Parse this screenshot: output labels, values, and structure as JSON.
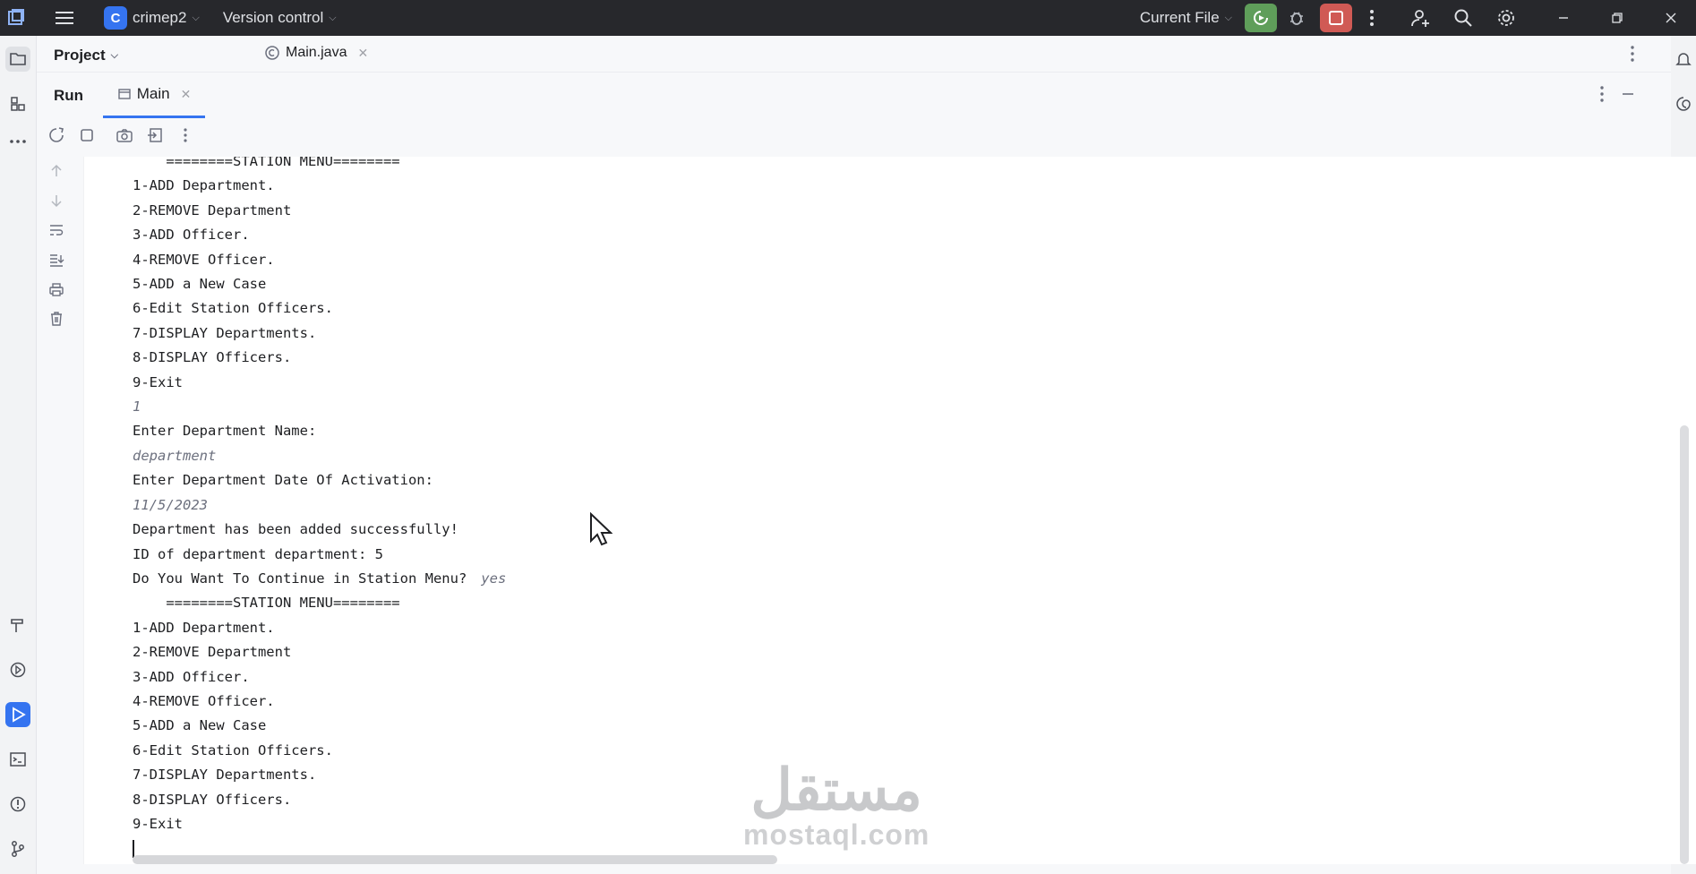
{
  "titlebar": {
    "project_initial": "C",
    "project_name": "crimep2",
    "vcs_label": "Version control",
    "run_config": "Current File"
  },
  "header": {
    "project_label": "Project",
    "file_tab": "Main.java"
  },
  "run_panel": {
    "tool_label": "Run",
    "tab_label": "Main"
  },
  "console": {
    "lines": [
      {
        "text": "    ========STATION MENU========",
        "type": "out"
      },
      {
        "text": "1-ADD Department.",
        "type": "out"
      },
      {
        "text": "2-REMOVE Department",
        "type": "out"
      },
      {
        "text": "3-ADD Officer.",
        "type": "out"
      },
      {
        "text": "4-REMOVE Officer.",
        "type": "out"
      },
      {
        "text": "5-ADD a New Case",
        "type": "out"
      },
      {
        "text": "6-Edit Station Officers.",
        "type": "out"
      },
      {
        "text": "7-DISPLAY Departments.",
        "type": "out"
      },
      {
        "text": "8-DISPLAY Officers.",
        "type": "out"
      },
      {
        "text": "9-Exit",
        "type": "out"
      },
      {
        "text": "1",
        "type": "input"
      },
      {
        "text": "Enter Department Name:",
        "type": "out"
      },
      {
        "text": "department",
        "type": "input"
      },
      {
        "text": "Enter Department Date Of Activation:",
        "type": "out"
      },
      {
        "text": "11/5/2023",
        "type": "input"
      },
      {
        "text": "Department has been added successfully!",
        "type": "out"
      },
      {
        "text": "ID of department department: 5",
        "type": "out"
      },
      {
        "text": "Do You Want To Continue in Station Menu?",
        "type": "out",
        "input": "yes"
      },
      {
        "text": "    ========STATION MENU========",
        "type": "out"
      },
      {
        "text": "1-ADD Department.",
        "type": "out"
      },
      {
        "text": "2-REMOVE Department",
        "type": "out"
      },
      {
        "text": "3-ADD Officer.",
        "type": "out"
      },
      {
        "text": "4-REMOVE Officer.",
        "type": "out"
      },
      {
        "text": "5-ADD a New Case",
        "type": "out"
      },
      {
        "text": "6-Edit Station Officers.",
        "type": "out"
      },
      {
        "text": "7-DISPLAY Departments.",
        "type": "out"
      },
      {
        "text": "8-DISPLAY Officers.",
        "type": "out"
      },
      {
        "text": "9-Exit",
        "type": "out"
      }
    ]
  },
  "watermark": {
    "arabic": "مستقل",
    "latin": "mostaql.com"
  },
  "colors": {
    "titlebar_bg": "#27282c",
    "accent": "#3574f0",
    "run_green": "#5f9e5a",
    "stop_red": "#d05a55"
  }
}
